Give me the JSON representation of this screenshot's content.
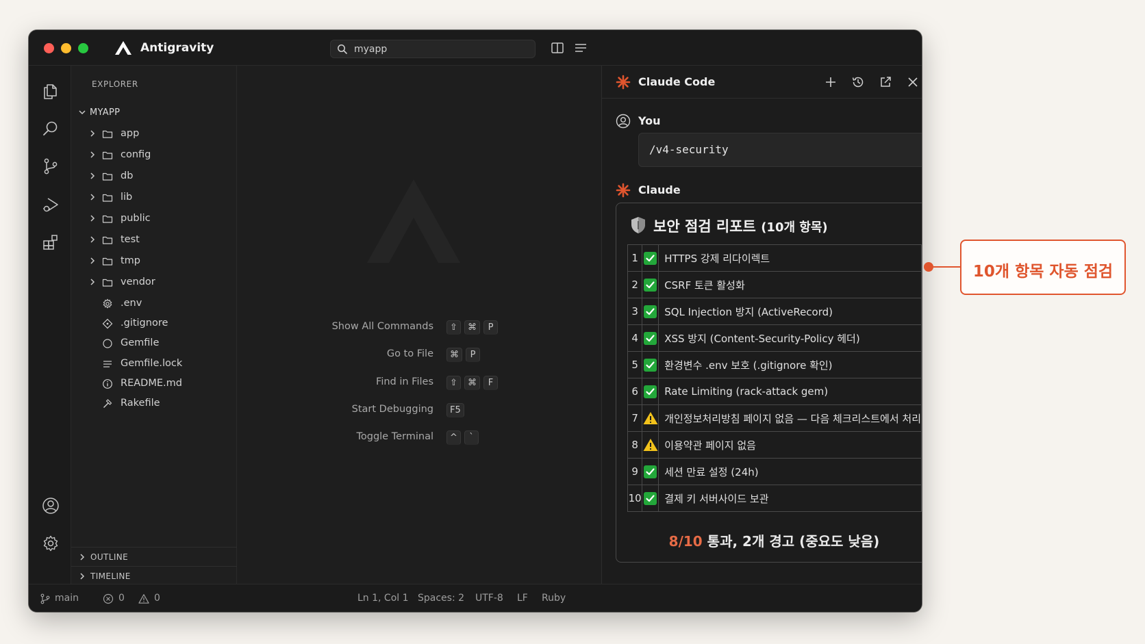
{
  "window": {
    "app_title": "Antigravity",
    "search_value": "myapp"
  },
  "sidebar": {
    "title": "EXPLORER",
    "root": "MYAPP",
    "folders": [
      "app",
      "config",
      "db",
      "lib",
      "public",
      "test",
      "tmp",
      "vendor"
    ],
    "files": [
      {
        "name": ".env",
        "icon": "gear-icon"
      },
      {
        "name": ".gitignore",
        "icon": "diamond-icon"
      },
      {
        "name": "Gemfile",
        "icon": "circle-icon"
      },
      {
        "name": "Gemfile.lock",
        "icon": "lines-icon"
      },
      {
        "name": "README.md",
        "icon": "info-icon"
      },
      {
        "name": "Rakefile",
        "icon": "hammer-icon"
      }
    ],
    "outline": "OUTLINE",
    "timeline": "TIMELINE"
  },
  "editor": {
    "commands": [
      {
        "label": "Show All Commands",
        "keys": [
          "⇧",
          "⌘",
          "P"
        ]
      },
      {
        "label": "Go to File",
        "keys": [
          "⌘",
          "P"
        ]
      },
      {
        "label": "Find in Files",
        "keys": [
          "⇧",
          "⌘",
          "F"
        ]
      },
      {
        "label": "Start Debugging",
        "keys": [
          "F5"
        ]
      },
      {
        "label": "Toggle Terminal",
        "keys": [
          "^",
          "`"
        ]
      }
    ]
  },
  "panel": {
    "title": "Claude Code",
    "you_label": "You",
    "prompt": "/v4-security",
    "claude_label": "Claude",
    "report_title": "보안 점검 리포트",
    "report_subtitle": "(10개 항목)",
    "checks": [
      {
        "num": "1",
        "status": "pass",
        "text": "HTTPS 강제 리다이렉트"
      },
      {
        "num": "2",
        "status": "pass",
        "text": "CSRF 토큰 활성화"
      },
      {
        "num": "3",
        "status": "pass",
        "text": "SQL Injection 방지 (ActiveRecord)"
      },
      {
        "num": "4",
        "status": "pass",
        "text": "XSS 방지 (Content-Security-Policy 헤더)"
      },
      {
        "num": "5",
        "status": "pass",
        "text": "환경변수 .env 보호 (.gitignore 확인)"
      },
      {
        "num": "6",
        "status": "pass",
        "text": "Rate Limiting (rack-attack gem)"
      },
      {
        "num": "7",
        "status": "warn",
        "text": "개인정보처리방침 페이지 없음 — 다음 체크리스트에서 처리"
      },
      {
        "num": "8",
        "status": "warn",
        "text": "이용약관 페이지 없음"
      },
      {
        "num": "9",
        "status": "pass",
        "text": "세션 만료 설정 (24h)"
      },
      {
        "num": "10",
        "status": "pass",
        "text": "결제 키 서버사이드 보관"
      }
    ],
    "summary_score": "8/10",
    "summary_text": " 통과, 2개 경고 (중요도 낮음)"
  },
  "statusbar": {
    "branch": "main",
    "errors": "0",
    "warnings": "0",
    "position": "Ln 1, Col 1",
    "spaces": "Spaces: 2",
    "encoding": "UTF-8",
    "eol": "LF",
    "language": "Ruby"
  },
  "callout": {
    "text": "10개 항목 자동 점검"
  },
  "colors": {
    "accent": "#e0552e",
    "pass": "#23a73a",
    "warn": "#f2c21b",
    "background": "#f6f3ee",
    "window": "#1e1e1e"
  }
}
